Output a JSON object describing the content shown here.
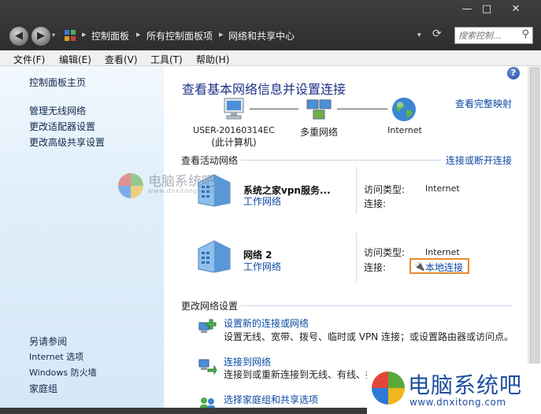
{
  "window": {
    "controls": {
      "minimize": "—",
      "maximize": "□",
      "close": "✕"
    },
    "back_glyph": "◀",
    "forward_glyph": "▶",
    "history_glyph": "▾",
    "breadcrumb": [
      "控制面板",
      "所有控制面板项",
      "网络和共享中心"
    ],
    "breadcrumb_sep": "▸",
    "address_dropdown_glyph": "▾",
    "refresh_glyph": "⟳",
    "search_placeholder": "搜索控制...",
    "search_glyph": "⚲"
  },
  "menu": [
    "文件(F)",
    "编辑(E)",
    "查看(V)",
    "工具(T)",
    "帮助(H)"
  ],
  "sidebar": {
    "items": [
      "控制面板主页",
      "管理无线网络",
      "更改适配器设置",
      "更改高级共享设置"
    ],
    "see_also_title": "另请参阅",
    "see_also": [
      "Internet 选项",
      "Windows 防火墙",
      "家庭组"
    ]
  },
  "main": {
    "help_glyph": "?",
    "title": "查看基本网络信息并设置连接",
    "full_map_link": "查看完整映射",
    "map": {
      "computer_line1": "USER-20160314EC",
      "computer_line2": "(此计算机)",
      "multi_network": "多重网络",
      "internet": "Internet"
    },
    "active_networks_label": "查看活动网络",
    "connect_disconnect_link": "连接或断开连接",
    "networks": [
      {
        "name": "系统之家vpn服务...",
        "type": "工作网络",
        "access_label": "访问类型:",
        "access_value": "Internet",
        "conn_label": "连接:",
        "conn_value": ""
      },
      {
        "name": "网络  2",
        "type": "工作网络",
        "access_label": "访问类型:",
        "access_value": "Internet",
        "conn_label": "连接:",
        "conn_value": "本地连接"
      }
    ],
    "conn_glyph": "🔌",
    "change_settings_label": "更改网络设置",
    "tasks": [
      {
        "title": "设置新的连接或网络",
        "desc": "设置无线、宽带、拨号、临时或 VPN 连接；或设置路由器或访问点。"
      },
      {
        "title": "连接到网络",
        "desc": "连接到或重新连接到无线、有线、拨号或 VPN 网络连接。"
      },
      {
        "title": "选择家庭组和共享选项",
        "desc": ""
      }
    ]
  },
  "watermarks": {
    "small_title": "电脑系统吧",
    "small_url": "www.dnxitong.com",
    "large_title": "电脑系统吧",
    "large_url": "www.dnxitong.com"
  },
  "colors": {
    "link": "#0b4aa5",
    "title": "#1e3287",
    "highlight_border": "#e88a2e",
    "sidebar_text": "#10284a"
  }
}
